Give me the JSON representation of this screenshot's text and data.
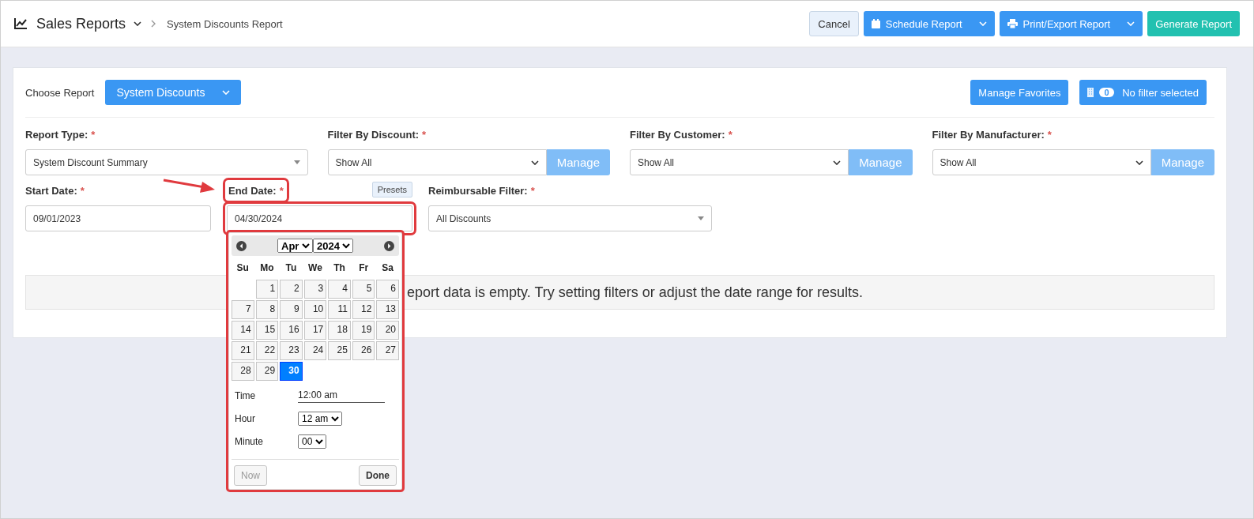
{
  "header": {
    "title": "Sales Reports",
    "breadcrumb": "System Discounts Report",
    "buttons": [
      {
        "label": "Cancel",
        "kind": "plain"
      },
      {
        "label": "Schedule Report",
        "kind": "split"
      },
      {
        "label": "Print/Export Report",
        "kind": "split"
      },
      {
        "label": "Generate Report",
        "kind": "accent"
      }
    ]
  },
  "toolbar": {
    "choose_label": "Choose Report",
    "report_button": "System Discounts",
    "manage_favorites": "Manage Favorites",
    "filter_count": "0",
    "filter_label": "No filter selected"
  },
  "filters": [
    {
      "label": "Report Type:",
      "mark": "*",
      "value": "System Discount Summary",
      "kind": "combo"
    },
    {
      "label": "Filter By Discount:",
      "mark": "*",
      "value": "Show All",
      "kind": "select-manage",
      "manage": "Manage"
    },
    {
      "label": "Filter By Customer:",
      "mark": "*",
      "value": "Show All",
      "kind": "select-manage",
      "manage": "Manage"
    },
    {
      "label": "Filter By Manufacturer:",
      "mark": "*",
      "value": "Show All",
      "kind": "select-manage",
      "manage": "Manage"
    }
  ],
  "dates": {
    "start": {
      "label": "Start Date:",
      "mark": "*",
      "value": "09/01/2023",
      "highlighted": false
    },
    "end": {
      "label": "End Date:",
      "mark": "*",
      "value": "04/30/2024",
      "highlighted": true
    },
    "presets": "Presets",
    "reimbursable": {
      "label": "Reimbursable Filter:",
      "mark": "*",
      "value": "All Discounts"
    }
  },
  "message": "eport data is empty. Try setting filters or adjust the date range for results.",
  "datepicker": {
    "highlighted": true,
    "month": "Apr",
    "year": "2024",
    "weekdays": [
      "Su",
      "Mo",
      "Tu",
      "We",
      "Th",
      "Fr",
      "Sa"
    ],
    "weeks": [
      [
        {
          "day": "1",
          "selected": false
        },
        {
          "day": "2",
          "selected": false
        },
        {
          "day": "3",
          "selected": false
        },
        {
          "day": "4",
          "selected": false
        },
        {
          "day": "5",
          "selected": false
        },
        {
          "day": "6",
          "selected": false
        }
      ],
      [
        {
          "day": "7",
          "selected": false
        },
        {
          "day": "8",
          "selected": false
        },
        {
          "day": "9",
          "selected": false
        },
        {
          "day": "10",
          "selected": false
        },
        {
          "day": "11",
          "selected": false
        },
        {
          "day": "12",
          "selected": false
        },
        {
          "day": "13",
          "selected": false
        }
      ],
      [
        {
          "day": "14",
          "selected": false
        },
        {
          "day": "15",
          "selected": false
        },
        {
          "day": "16",
          "selected": false
        },
        {
          "day": "17",
          "selected": false
        },
        {
          "day": "18",
          "selected": false
        },
        {
          "day": "19",
          "selected": false
        },
        {
          "day": "20",
          "selected": false
        }
      ],
      [
        {
          "day": "21",
          "selected": false
        },
        {
          "day": "22",
          "selected": false
        },
        {
          "day": "23",
          "selected": false
        },
        {
          "day": "24",
          "selected": false
        },
        {
          "day": "25",
          "selected": false
        },
        {
          "day": "26",
          "selected": false
        },
        {
          "day": "27",
          "selected": false
        }
      ],
      [
        {
          "day": "28",
          "selected": false
        },
        {
          "day": "29",
          "selected": false
        },
        {
          "day": "30",
          "selected": true
        }
      ]
    ],
    "time_label": "Time",
    "time_value": "12:00 am",
    "hour_label": "Hour",
    "hour": "12 am",
    "minute_label": "Minute",
    "minute": "00",
    "now": {
      "label": "Now",
      "disabled": true
    },
    "done": {
      "label": "Done",
      "disabled": false
    }
  }
}
